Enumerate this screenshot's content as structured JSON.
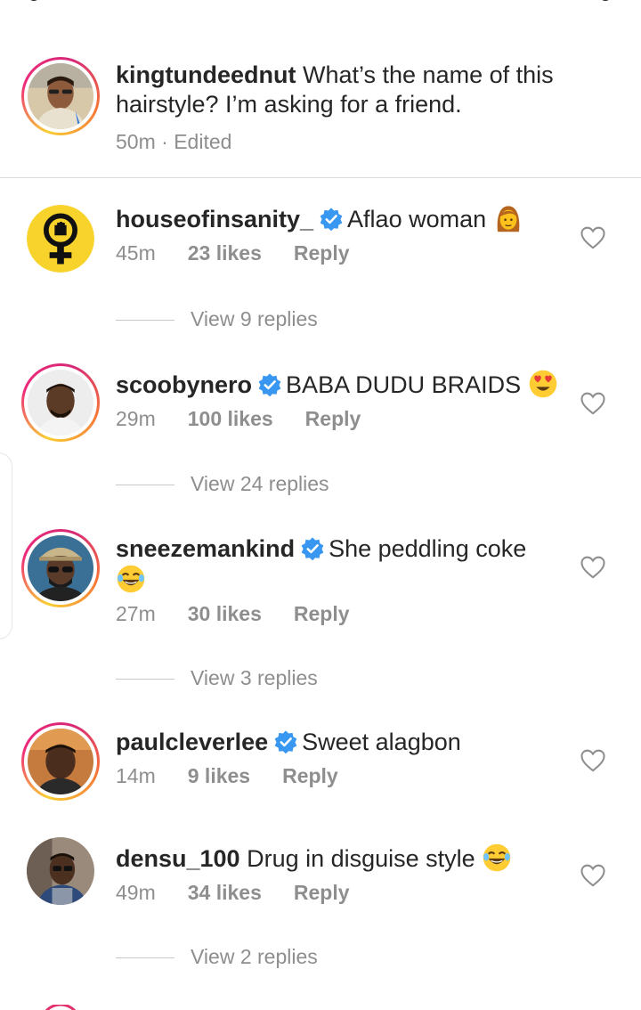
{
  "caption": {
    "username": "kingtundeednut",
    "text": " What’s the name of this hairstyle? I’m asking for a friend.",
    "time": "50m",
    "separator": " · ",
    "edited": "Edited"
  },
  "comments": [
    {
      "username": "houseofinsanity_",
      "text": "Aflao woman",
      "time": "45m",
      "likes": "23 likes",
      "reply": "Reply",
      "view_replies": "View 9 replies"
    },
    {
      "username": "scoobynero",
      "text": "BABA DUDU BRAIDS",
      "time": "29m",
      "likes": "100 likes",
      "reply": "Reply",
      "view_replies": "View 24 replies"
    },
    {
      "username": "sneezemankind",
      "text": "She peddling coke",
      "time": "27m",
      "likes": "30 likes",
      "reply": "Reply",
      "view_replies": "View 3 replies"
    },
    {
      "username": "paulcleverlee",
      "text": "Sweet alagbon",
      "time": "14m",
      "likes": "9 likes",
      "reply": "Reply"
    },
    {
      "username": "densu_100",
      "text": " Drug in disguise style",
      "time": "49m",
      "likes": "34 likes",
      "reply": "Reply",
      "view_replies": "View 2 replies"
    }
  ],
  "colors": {
    "verified": "#3897f0",
    "meta": "#8e8e8e",
    "text": "#262626"
  },
  "icons": [
    "verified-badge-icon",
    "heart-icon",
    "woman-emoji",
    "heart-eyes-emoji",
    "laughing-emoji"
  ]
}
